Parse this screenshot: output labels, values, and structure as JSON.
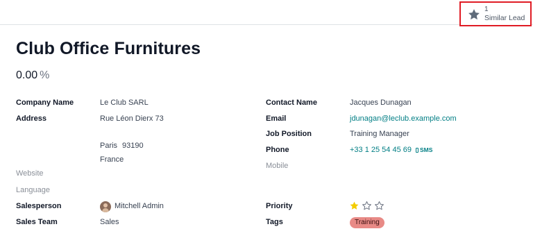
{
  "smart_button": {
    "count": "1",
    "label": "Similar Lead",
    "icon": "star-icon"
  },
  "lead": {
    "title": "Club Office Furnitures",
    "probability": "0.00",
    "probability_unit": "%"
  },
  "left": {
    "company_name": {
      "label": "Company Name",
      "value": "Le Club SARL"
    },
    "address": {
      "label": "Address",
      "street": "Rue Léon Dierx 73",
      "city": "Paris",
      "zip": "93190",
      "country": "France"
    },
    "website": {
      "label": "Website"
    },
    "language": {
      "label": "Language"
    },
    "salesperson": {
      "label": "Salesperson",
      "value": "Mitchell Admin"
    },
    "sales_team": {
      "label": "Sales Team",
      "value": "Sales"
    }
  },
  "right": {
    "contact_name": {
      "label": "Contact Name",
      "value": "Jacques Dunagan"
    },
    "email": {
      "label": "Email",
      "value": "jdunagan@leclub.example.com"
    },
    "job_position": {
      "label": "Job Position",
      "value": "Training Manager"
    },
    "phone": {
      "label": "Phone",
      "value": "+33 1 25 54 45 69",
      "sms_label": "SMS"
    },
    "mobile": {
      "label": "Mobile"
    },
    "priority": {
      "label": "Priority",
      "stars_filled": 1,
      "stars_total": 3,
      "filled_color": "#f3cc00",
      "empty_color": "#6b7280"
    },
    "tags": {
      "label": "Tags",
      "items": [
        "Training"
      ],
      "tag_color": "#e88a86"
    }
  }
}
